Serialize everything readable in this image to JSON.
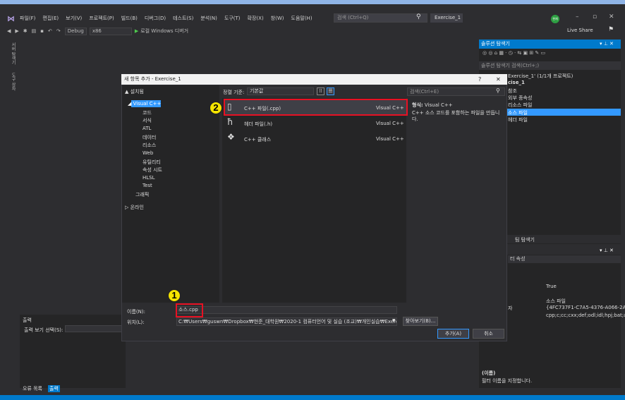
{
  "menubar": {
    "items": [
      "파일(F)",
      "편집(E)",
      "보기(V)",
      "프로젝트(P)",
      "빌드(B)",
      "디버그(D)",
      "테스트(S)",
      "분석(N)",
      "도구(T)",
      "확장(X)",
      "창(W)",
      "도움말(H)"
    ],
    "search_placeholder": "검색 (Ctrl+Q)",
    "project_name": "Exercise_1",
    "profile_initials": "현재"
  },
  "toolbar": {
    "config": "Debug",
    "platform": "x86",
    "run_label": "로컬 Windows 디버거",
    "live_share": "Live Share"
  },
  "side_tabs": [
    "서버 탐색기",
    "도구 상자"
  ],
  "solution_explorer": {
    "title": "솔루션 탐색기",
    "search_placeholder": "솔루션 탐색기 검색(Ctrl+;)",
    "rows": [
      "Exercise_1' (1/1개 프로젝트)",
      "cise_1",
      "참조",
      "외부 종속성",
      "리소스 파일",
      "소스 파일",
      "헤더 파일"
    ],
    "selected_row": "소스 파일",
    "team_tab": "팀 탐색기"
  },
  "properties": {
    "combo": "터 속성",
    "value_true": "True",
    "value_name": "소스 파일",
    "value_guid": "{4FC737F1-C7A5-4376-A066-2A32",
    "value_ext": "cpp;c;cc;cxx;def;odl;idl;hpj;bat;asm;",
    "partial_label": "자",
    "desc_title": "(이름)",
    "desc_text": "필터 이름을 지정합니다."
  },
  "output": {
    "title": "출력",
    "show_label": "출력 보기 선택(S):",
    "tabs": [
      "오류 목록",
      "출력"
    ]
  },
  "dialog": {
    "title": "새 항목 추가 - Exercise_1",
    "help": "?",
    "close": "✕",
    "tree_installed": "▲ 설치됨",
    "tree_selected": "Visual C++",
    "tree_children": [
      "코드",
      "서식",
      "ATL",
      "데이터",
      "리소스",
      "Web",
      "유틸리티",
      "속성 시트",
      "HLSL",
      "Test"
    ],
    "tree_graphics": "그래픽",
    "tree_online": "▷ 온라인",
    "sort_label": "정렬 기준:",
    "sort_value": "기본값",
    "templates": [
      {
        "name": "C++ 파일(.cpp)",
        "lang": "Visual C++"
      },
      {
        "name": "헤더 파일(.h)",
        "lang": "Visual C++"
      },
      {
        "name": "C++ 클래스",
        "lang": "Visual C++"
      }
    ],
    "search_placeholder": "검색(Ctrl+E)",
    "type_label": "형식:",
    "type_value": "Visual C++",
    "description": "C++ 소스 코드를 포함하는 파일을 만듭니다.",
    "name_label": "이름(N):",
    "name_value": "소스.cpp",
    "location_label": "위치(L):",
    "location_value": "C:₩Users₩guswn₩Dropbox₩현준_대학원₩2020-1 컴퓨터언어 및 실습 (조교)₩개인실습₩Exercise_",
    "browse_label": "찾아보기(B)...",
    "add_label": "추가(A)",
    "cancel_label": "취소"
  },
  "callouts": [
    "1",
    "2"
  ],
  "colors": {
    "accent": "#007acc",
    "highlight": "#e81123",
    "callout": "#f5e400",
    "selection": "#3399ff"
  }
}
